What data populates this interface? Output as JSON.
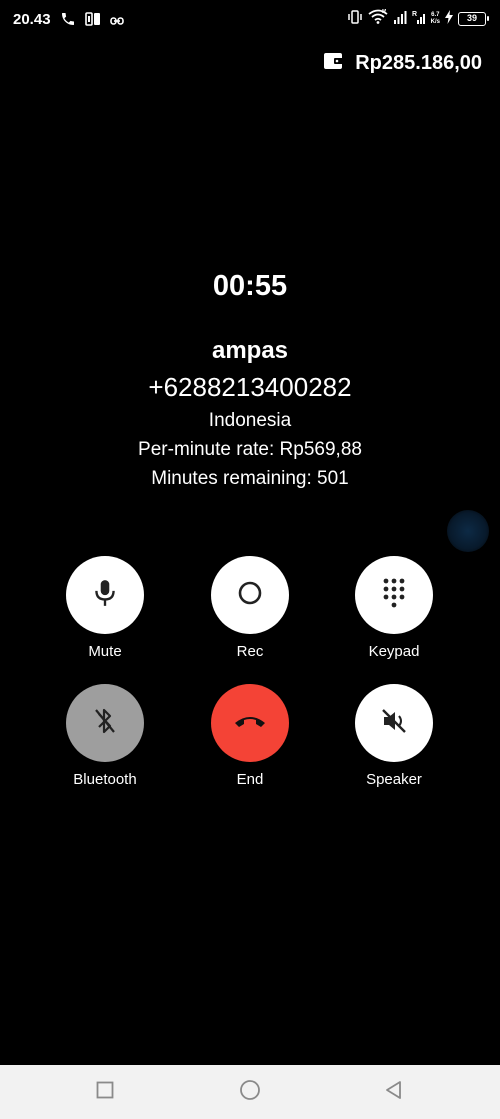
{
  "status_bar": {
    "time": "20.43",
    "battery": "39",
    "net_speed_top": "6.7",
    "net_speed_bottom": "K/s",
    "left_icons": [
      "phone-icon",
      "sim-icon",
      "link-icon"
    ],
    "right_icons": [
      "vibrate-icon",
      "wifi-icon",
      "signal-icon",
      "signal-icon",
      "charging-icon",
      "battery-icon"
    ]
  },
  "balance": {
    "icon": "wallet-icon",
    "amount": "Rp285.186,00"
  },
  "call": {
    "timer": "00:55",
    "name": "ampas",
    "number": "+6288213400282",
    "country": "Indonesia",
    "rate": "Per-minute rate: Rp569,88",
    "remaining": "Minutes remaining: 501"
  },
  "actions": {
    "mute": {
      "label": "Mute",
      "icon": "microphone-icon"
    },
    "rec": {
      "label": "Rec",
      "icon": "record-icon"
    },
    "keypad": {
      "label": "Keypad",
      "icon": "keypad-icon"
    },
    "bluetooth": {
      "label": "Bluetooth",
      "icon": "bluetooth-off-icon"
    },
    "end": {
      "label": "End",
      "icon": "end-call-icon",
      "color": "#f44336"
    },
    "speaker": {
      "label": "Speaker",
      "icon": "speaker-off-icon"
    }
  },
  "nav_bar": {
    "items": [
      "recent-apps-icon",
      "home-icon",
      "back-icon"
    ]
  }
}
